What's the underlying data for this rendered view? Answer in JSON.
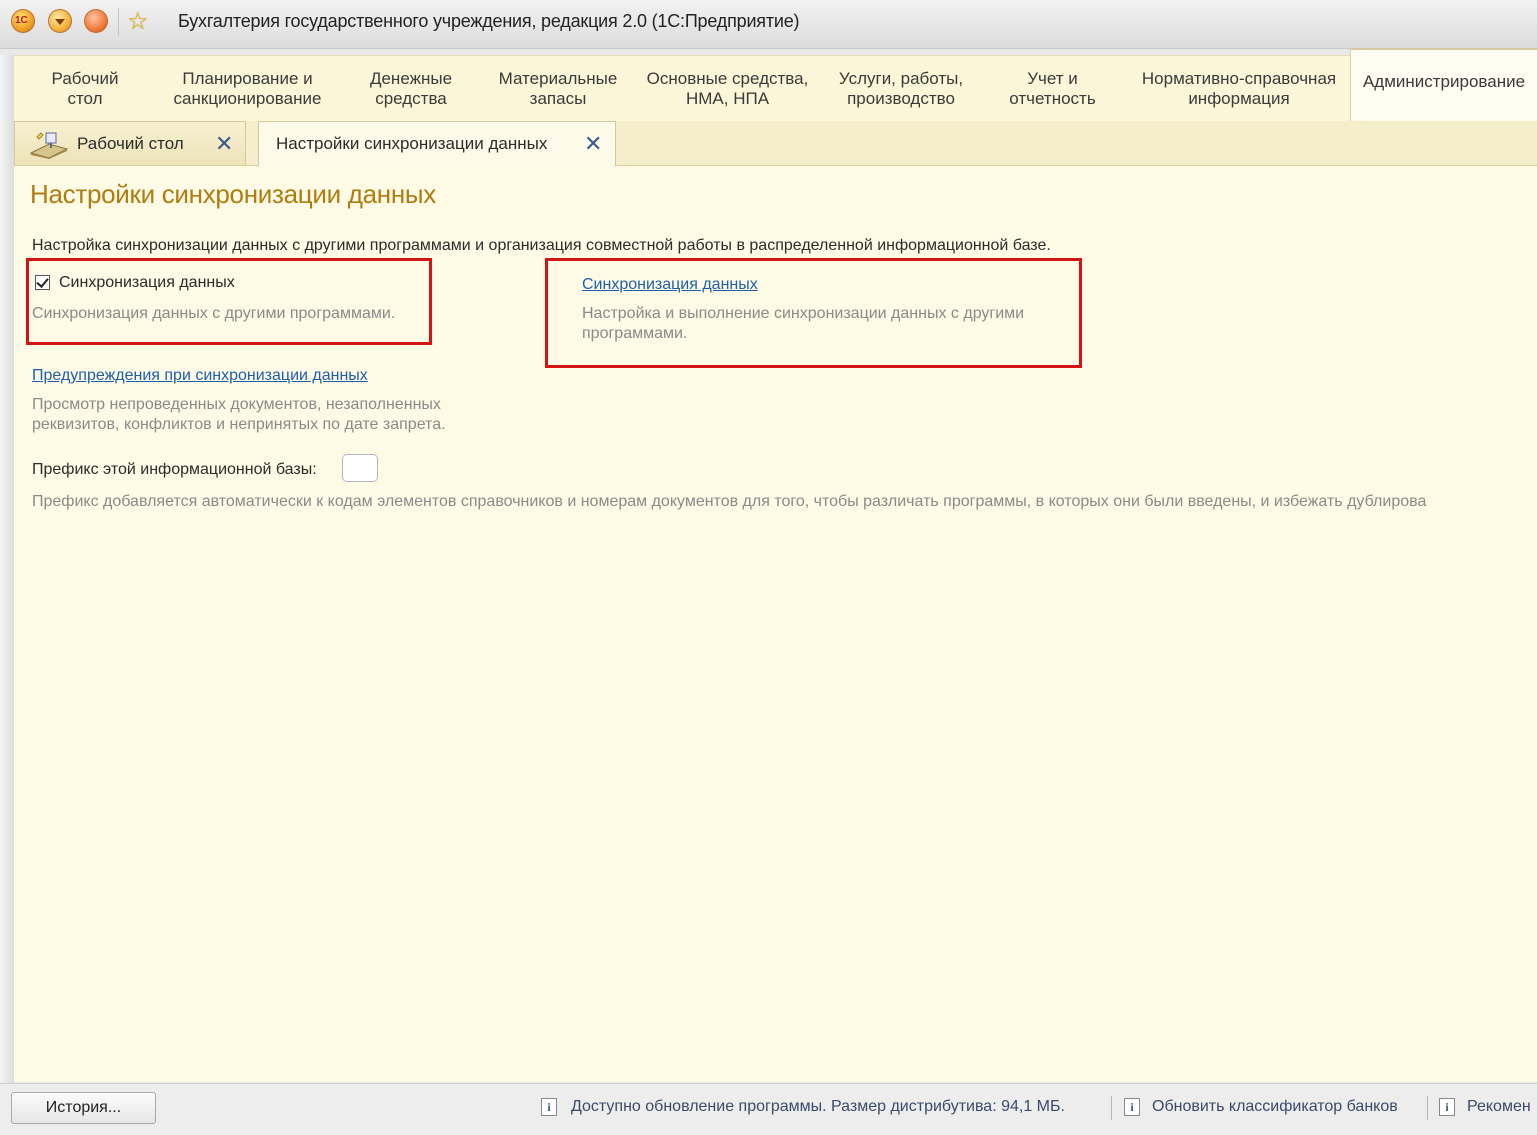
{
  "window": {
    "title": "Бухгалтерия государственного учреждения, редакция 2.0  (1С:Предприятие)",
    "logo_text": "1С"
  },
  "sections": [
    {
      "label": "Рабочий\nстол"
    },
    {
      "label": "Планирование и\nсанкционирование"
    },
    {
      "label": "Денежные\nсредства"
    },
    {
      "label": "Материальные\nзапасы"
    },
    {
      "label": "Основные средства,\nНМА, НПА"
    },
    {
      "label": "Услуги, работы,\nпроизводство"
    },
    {
      "label": "Учет и\nотчетность"
    },
    {
      "label": "Нормативно-справочная\nинформация"
    },
    {
      "label": "Администрирование"
    }
  ],
  "tabs": [
    {
      "label": "Рабочий стол",
      "close": "✕"
    },
    {
      "label": "Настройки синхронизации данных",
      "close": "✕"
    }
  ],
  "form": {
    "title": "Настройки синхронизации данных",
    "intro": "Настройка синхронизации данных с другими программами и организация совместной работы в распределенной информационной базе.",
    "sync_checkbox": {
      "label": "Синхронизация данных",
      "checked": true,
      "hint": "Синхронизация данных с другими программами."
    },
    "sync_link": {
      "label": "Синхронизация данных",
      "hint": "Настройка и выполнение синхронизации данных с другими программами."
    },
    "warnings_link": {
      "label": "Предупреждения при синхронизации данных",
      "hint": "Просмотр непроведенных документов, незаполненных реквизитов, конфликтов и непринятых по дате запрета."
    },
    "prefix": {
      "label": "Префикс этой информационной базы:",
      "value": "",
      "hint": "Префикс добавляется автоматически к кодам элементов справочников и номерам документов для того, чтобы различать программы, в которых они были введены, и избежать дублирова"
    }
  },
  "statusbar": {
    "history_label": "История...",
    "items": [
      {
        "icon": "info-icon",
        "text": "Доступно обновление программы. Размер дистрибутива: 94,1 МБ."
      },
      {
        "icon": "info-icon",
        "text": "Обновить классификатор банков"
      },
      {
        "icon": "info-icon",
        "text": "Рекомен"
      }
    ]
  },
  "colors": {
    "accent_title": "#b07c10",
    "link": "#1f5faa",
    "highlight_box": "#d41414",
    "form_background": "#fdfbe6"
  }
}
